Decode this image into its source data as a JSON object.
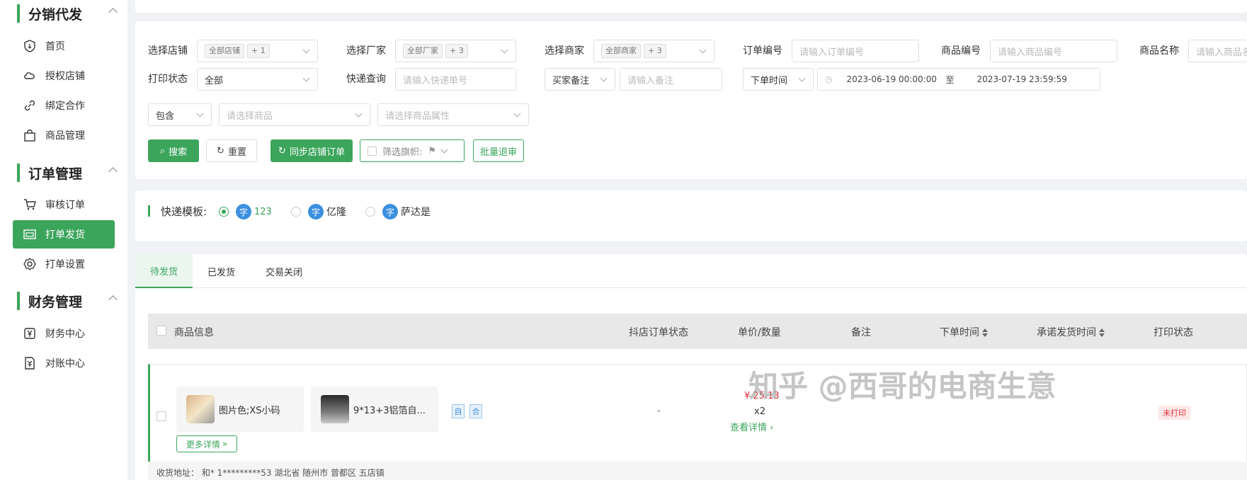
{
  "sidebar": {
    "sections": [
      {
        "title": "分销代发",
        "items": [
          "首页",
          "授权店铺",
          "绑定合作",
          "商品管理"
        ]
      },
      {
        "title": "订单管理",
        "items": [
          "审核订单",
          "打单发货",
          "打单设置"
        ]
      },
      {
        "title": "财务管理",
        "items": [
          "财务中心",
          "对账中心"
        ]
      }
    ],
    "active_item": "打单发货"
  },
  "filters": {
    "shop_label": "选择店铺",
    "shop_tag": "全部店铺",
    "shop_more": "+ 1",
    "factory_label": "选择厂家",
    "factory_tag": "全部厂家",
    "factory_more": "+ 3",
    "merchant_label": "选择商家",
    "merchant_tag": "全部商家",
    "merchant_more": "+ 3",
    "order_no_label": "订单编号",
    "order_no_placeholder": "请输入订单编号",
    "goods_no_label": "商品编号",
    "goods_no_placeholder": "请输入商品编号",
    "goods_name_label": "商品名称",
    "goods_name_placeholder": "请输入商品名称",
    "print_status_label": "打印状态",
    "print_status_value": "全部",
    "express_label": "快递查询",
    "express_placeholder": "请输入快递单号",
    "remark_select": "买家备注",
    "remark_placeholder": "请输入备注",
    "time_select": "下单时间",
    "date_start": "2023-06-19 00:00:00",
    "date_sep": "至",
    "date_end": "2023-07-19 23:59:59",
    "contain_select": "包含",
    "goods_select_placeholder": "请选择商品",
    "attr_select_placeholder": "请选择商品属性"
  },
  "buttons": {
    "search": "搜索",
    "reset": "重置",
    "sync": "同步店铺订单",
    "flag_filter": "筛选旗帜:",
    "batch_return": "批量退审"
  },
  "express_template": {
    "label": "快递模板:",
    "options": [
      {
        "label": "123",
        "selected": true
      },
      {
        "label": "亿隆",
        "selected": false
      },
      {
        "label": "萨达是",
        "selected": false
      }
    ],
    "badge": "字"
  },
  "tabs": [
    "待发货",
    "已发货",
    "交易关闭"
  ],
  "active_tab": "待发货",
  "table": {
    "columns": [
      "商品信息",
      "抖店订单状态",
      "单价/数量",
      "备注",
      "下单时间",
      "承诺发货时间",
      "打印状态"
    ],
    "row": {
      "spec": "图片色;XS小码",
      "product": "9*13+3铝箔自...",
      "badge1": "自",
      "badge2": "合",
      "status": "-",
      "price": "¥ 25.13",
      "qty": "x2",
      "detail_link": "查看详情",
      "more_details": "更多详情",
      "print_status": "未打印"
    },
    "address_line": "收货地址：    和* 1*********53 湖北省 随州市 曾都区 五店镇"
  },
  "watermark": "知乎 @西哥的电商生意",
  "colors": {
    "accent": "#3ca55c",
    "price": "#e0343a",
    "badge_blue": "#3b8fe0"
  }
}
